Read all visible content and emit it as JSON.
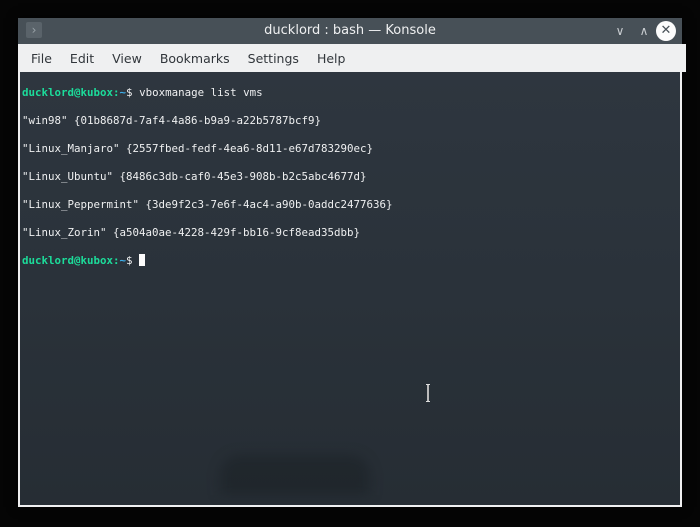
{
  "window": {
    "title": "ducklord : bash — Konsole",
    "app_icon": "terminal-prompt-icon"
  },
  "title_buttons": {
    "minimize": "chevron-down-icon",
    "maximize": "chevron-up-icon",
    "close": "close-icon"
  },
  "menu": [
    "File",
    "Edit",
    "View",
    "Bookmarks",
    "Settings",
    "Help"
  ],
  "terminal": {
    "prompt_user": "ducklord@kubox",
    "prompt_sep": ":",
    "prompt_path": "~",
    "prompt_symbol": "$ ",
    "command": "vboxmanage list vms",
    "output": [
      "\"win98\" {01b8687d-7af4-4a86-b9a9-a22b5787bcf9}",
      "\"Linux_Manjaro\" {2557fbed-fedf-4ea6-8d11-e67d783290ec}",
      "\"Linux_Ubuntu\" {8486c3db-caf0-45e3-908b-b2c5abc4677d}",
      "\"Linux_Peppermint\" {3de9f2c3-7e6f-4ac4-a90b-0addc2477636}",
      "\"Linux_Zorin\" {a504a0ae-4228-429f-bb16-9cf8ead35dbb}"
    ]
  },
  "colors": {
    "prompt_user": "#1cdc9a",
    "prompt_path": "#3daee9",
    "titlebar": "#475057"
  }
}
